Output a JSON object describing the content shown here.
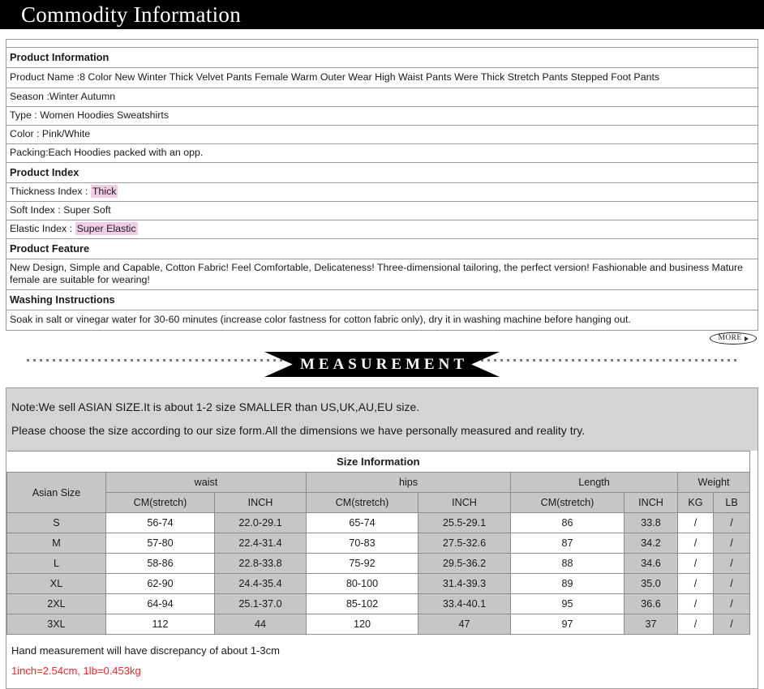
{
  "header": {
    "title": "Commodity Information"
  },
  "product_info": {
    "section_label": "Product Information",
    "rows": [
      {
        "text": "Product Name :8 Color New Winter Thick Velvet Pants Female Warm Outer Wear High Waist Pants Were Thick Stretch Pants Stepped Foot Pants"
      },
      {
        "text": "Season :Winter Autumn"
      },
      {
        "text": "Type : Women Hoodies Sweatshirts"
      },
      {
        "text": "Color : Pink/White"
      },
      {
        "text": "Packing:Each Hoodies packed with an opp."
      }
    ]
  },
  "product_index": {
    "section_label": "Product Index",
    "thickness_label": "Thickness Index :  ",
    "thickness_value": "Thick",
    "soft_label": "Soft Index :  Super Soft",
    "elastic_label": "Elastic Index : ",
    "elastic_value": "Super Elastic"
  },
  "product_feature": {
    "section_label": "Product Feature",
    "text": "New Design, Simple and Capable, Cotton Fabric! Feel Comfortable, Delicateness! Three-dimensional tailoring, the perfect version! Fashionable and business Mature female are suitable for wearing!"
  },
  "washing": {
    "section_label": "Washing Instructions",
    "text": "Soak in salt or vinegar water for 30-60 minutes (increase color fastness for cotton fabric only), dry it in washing machine before hanging out."
  },
  "more_button": {
    "label": "MORE",
    "icon": "play-arrow-icon"
  },
  "measurement_banner": {
    "label": "MEASUREMENT"
  },
  "notes": {
    "line1": "Note:We sell ASIAN SIZE.It is about 1-2 size SMALLER than US,UK,AU,EU size.",
    "line2": "Please choose the size according to our size form.All the dimensions we have personally measured and reality try."
  },
  "size_table": {
    "title": "Size Information",
    "group_headers": {
      "asian_size": "Asian Size",
      "waist": "waist",
      "hips": "hips",
      "length": "Length",
      "weight": "Weight"
    },
    "weight_color": "#ff0000",
    "sub_headers": {
      "waist_cm": "CM(stretch)",
      "waist_inch": "INCH",
      "hips_cm": "CM(stretch)",
      "hips_inch": "INCH",
      "length_cm": "CM(stretch)",
      "length_inch": "INCH",
      "kg": "KG",
      "lb": "LB"
    },
    "rows": [
      {
        "size": "S",
        "waist_cm": "56-74",
        "waist_inch": "22.0-29.1",
        "hips_cm": "65-74",
        "hips_inch": "25.5-29.1",
        "length_cm": "86",
        "length_inch": "33.8",
        "kg": "/",
        "lb": "/"
      },
      {
        "size": "M",
        "waist_cm": "57-80",
        "waist_inch": "22.4-31.4",
        "hips_cm": "70-83",
        "hips_inch": "27.5-32.6",
        "length_cm": "87",
        "length_inch": "34.2",
        "kg": "/",
        "lb": "/"
      },
      {
        "size": "L",
        "waist_cm": "58-86",
        "waist_inch": "22.8-33.8",
        "hips_cm": "75-92",
        "hips_inch": "29.5-36.2",
        "length_cm": "88",
        "length_inch": "34.6",
        "kg": "/",
        "lb": "/"
      },
      {
        "size": "XL",
        "waist_cm": "62-90",
        "waist_inch": "24.4-35.4",
        "hips_cm": "80-100",
        "hips_inch": "31.4-39.3",
        "length_cm": "89",
        "length_inch": "35.0",
        "kg": "/",
        "lb": "/"
      },
      {
        "size": "2XL",
        "waist_cm": "64-94",
        "waist_inch": "25.1-37.0",
        "hips_cm": "85-102",
        "hips_inch": "33.4-40.1",
        "length_cm": "95",
        "length_inch": "36.6",
        "kg": "/",
        "lb": "/"
      },
      {
        "size": "3XL",
        "waist_cm": "112",
        "waist_inch": "44",
        "hips_cm": "120",
        "hips_inch": "47",
        "length_cm": "97",
        "length_inch": "37",
        "kg": "/",
        "lb": "/"
      }
    ]
  },
  "footer": {
    "line1": "Hand measurement will have discrepancy of about 1-3cm",
    "line2": "1inch=2.54cm, 1lb=0.453kg",
    "line2_color": "#ff2222"
  }
}
